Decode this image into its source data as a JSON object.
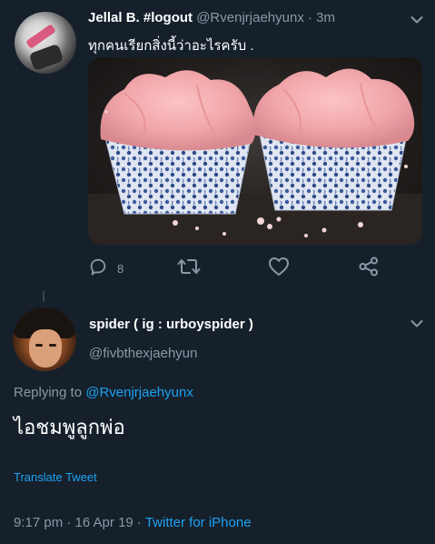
{
  "tweet": {
    "author_name": "Jellal B. #logout",
    "author_handle": "@Rvenjrjaehyunx",
    "time_sep": "·",
    "time": "3m",
    "text": "ทุกคนเรียกสิ่งนี้ว่าอะไรครับ .",
    "image_icon": "cupcakes-photo",
    "actions": {
      "reply_icon": "reply-icon",
      "reply_count": "8",
      "retweet_icon": "retweet-icon",
      "like_icon": "heart-icon",
      "share_icon": "share-icon"
    }
  },
  "reply_tweet": {
    "author_name": "spider ( ig : urboyspider )",
    "author_handle": "@fivbthexjaehyun",
    "replying_to_label": "Replying to",
    "replying_to_handle": "@Rvenjrjaehyunx",
    "text": "ไอชมพูลูกพ่อ",
    "translate_label": "Translate Tweet",
    "timestamp": "9:17 pm · 16 Apr 19 ·",
    "source": "Twitter for iPhone"
  },
  "colors": {
    "background": "#15202b",
    "text_primary": "#ffffff",
    "text_secondary": "#8899a6",
    "accent": "#1da1f2"
  }
}
